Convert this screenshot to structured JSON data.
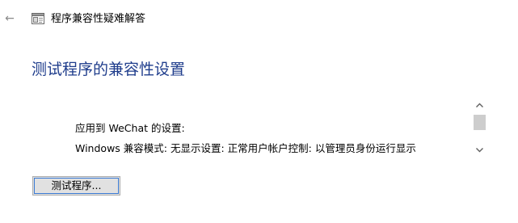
{
  "window": {
    "title": "程序兼容性疑难解答",
    "back_icon": "back-arrow-icon",
    "app_icon": "troubleshooter-icon"
  },
  "main": {
    "heading": "测试程序的兼容性设置",
    "settings_applied": "应用到 WeChat 的设置:",
    "settings_detail": "Windows 兼容模式: 无显示设置:  正常用户帐户控制:  以管理员身份运行显示",
    "test_button_label": "测试程序..."
  },
  "colors": {
    "heading": "#1f3d8c",
    "button_bg": "#e1e1e1",
    "focus_ring": "#3b7bd4"
  }
}
